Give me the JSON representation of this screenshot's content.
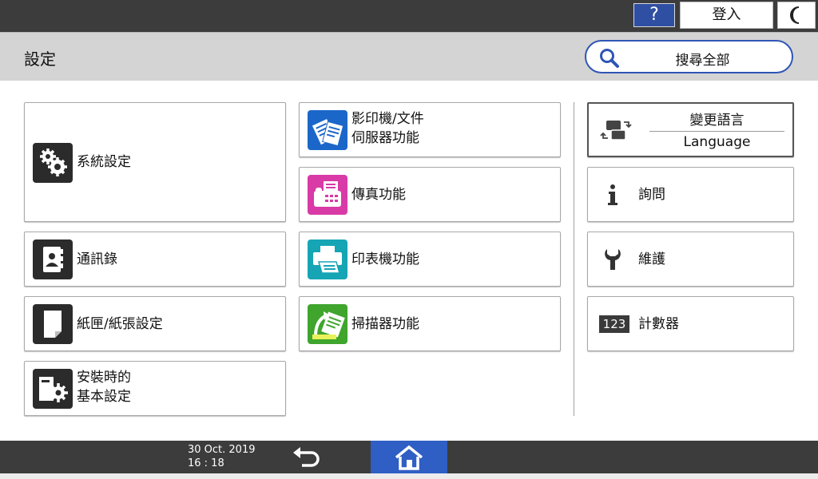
{
  "topbar": {
    "help_label": "?",
    "login_label": "登入",
    "moon_icon": "moon-icon"
  },
  "header": {
    "title": "設定",
    "search_label": "搜尋全部",
    "search_icon": "search-icon"
  },
  "tiles": {
    "system_settings": "系統設定",
    "address_book": "通訊錄",
    "tray_paper": "紙匣/紙張設定",
    "initial_setup_line1": "安裝時的",
    "initial_setup_line2": "基本設定",
    "copier_line1": "影印機/文件",
    "copier_line2": "伺服器功能",
    "fax": "傳真功能",
    "printer": "印表機功能",
    "scanner": "掃描器功能"
  },
  "right": {
    "language_top": "變更語言",
    "language_bottom": "Language",
    "inquiry": "詢問",
    "maintenance": "維護",
    "counter": "計數器",
    "counter_icon_text": "123"
  },
  "bottombar": {
    "date": "30 Oct. 2019",
    "time": "16 : 18"
  },
  "colors": {
    "topbar": "#3c3c3c",
    "accent_blue": "#2f56b5",
    "home_blue": "#2f5ec4",
    "header_gray": "#d4d4d4"
  }
}
